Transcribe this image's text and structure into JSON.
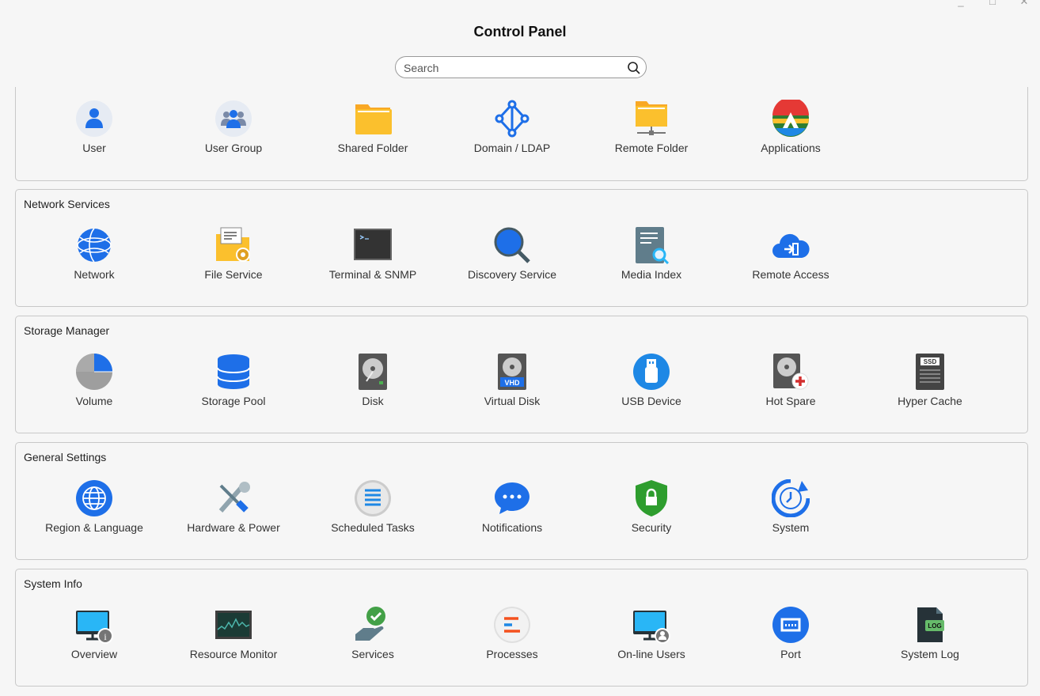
{
  "window": {
    "title": "Control Panel",
    "controls": [
      "minimize-icon",
      "maximize-icon",
      "close-icon"
    ]
  },
  "search": {
    "placeholder": "Search",
    "value": "",
    "icon": "search-icon"
  },
  "colors": {
    "accent": "#1e6fe8",
    "folder": "#fbc02d",
    "background": "#f6f6f6",
    "border": "#c8c8c8"
  },
  "sections": [
    {
      "title": "",
      "items": [
        {
          "label": "User",
          "icon": "user"
        },
        {
          "label": "User Group",
          "icon": "user-group"
        },
        {
          "label": "Shared Folder",
          "icon": "folder"
        },
        {
          "label": "Domain / LDAP",
          "icon": "ldap"
        },
        {
          "label": "Remote Folder",
          "icon": "remote-folder"
        },
        {
          "label": "Applications",
          "icon": "applications"
        }
      ]
    },
    {
      "title": "Network Services",
      "items": [
        {
          "label": "Network",
          "icon": "network"
        },
        {
          "label": "File Service",
          "icon": "file-service"
        },
        {
          "label": "Terminal & SNMP",
          "icon": "terminal"
        },
        {
          "label": "Discovery Service",
          "icon": "discovery"
        },
        {
          "label": "Media Index",
          "icon": "media-index"
        },
        {
          "label": "Remote Access",
          "icon": "remote-access"
        }
      ]
    },
    {
      "title": "Storage Manager",
      "items": [
        {
          "label": "Volume",
          "icon": "volume"
        },
        {
          "label": "Storage Pool",
          "icon": "storage-pool"
        },
        {
          "label": "Disk",
          "icon": "disk"
        },
        {
          "label": "Virtual Disk",
          "icon": "virtual-disk"
        },
        {
          "label": "USB Device",
          "icon": "usb"
        },
        {
          "label": "Hot Spare",
          "icon": "hot-spare"
        },
        {
          "label": "Hyper Cache",
          "icon": "ssd"
        }
      ]
    },
    {
      "title": "General Settings",
      "items": [
        {
          "label": "Region & Language",
          "icon": "globe"
        },
        {
          "label": "Hardware & Power",
          "icon": "tools"
        },
        {
          "label": "Scheduled Tasks",
          "icon": "tasks"
        },
        {
          "label": "Notifications",
          "icon": "chat"
        },
        {
          "label": "Security",
          "icon": "shield"
        },
        {
          "label": "System",
          "icon": "system"
        }
      ]
    },
    {
      "title": "System Info",
      "items": [
        {
          "label": "Overview",
          "icon": "monitor-info"
        },
        {
          "label": "Resource Monitor",
          "icon": "resource-monitor"
        },
        {
          "label": "Services",
          "icon": "services"
        },
        {
          "label": "Processes",
          "icon": "processes"
        },
        {
          "label": "On-line Users",
          "icon": "monitor-user"
        },
        {
          "label": "Port",
          "icon": "port"
        },
        {
          "label": "System Log",
          "icon": "log"
        }
      ]
    }
  ]
}
